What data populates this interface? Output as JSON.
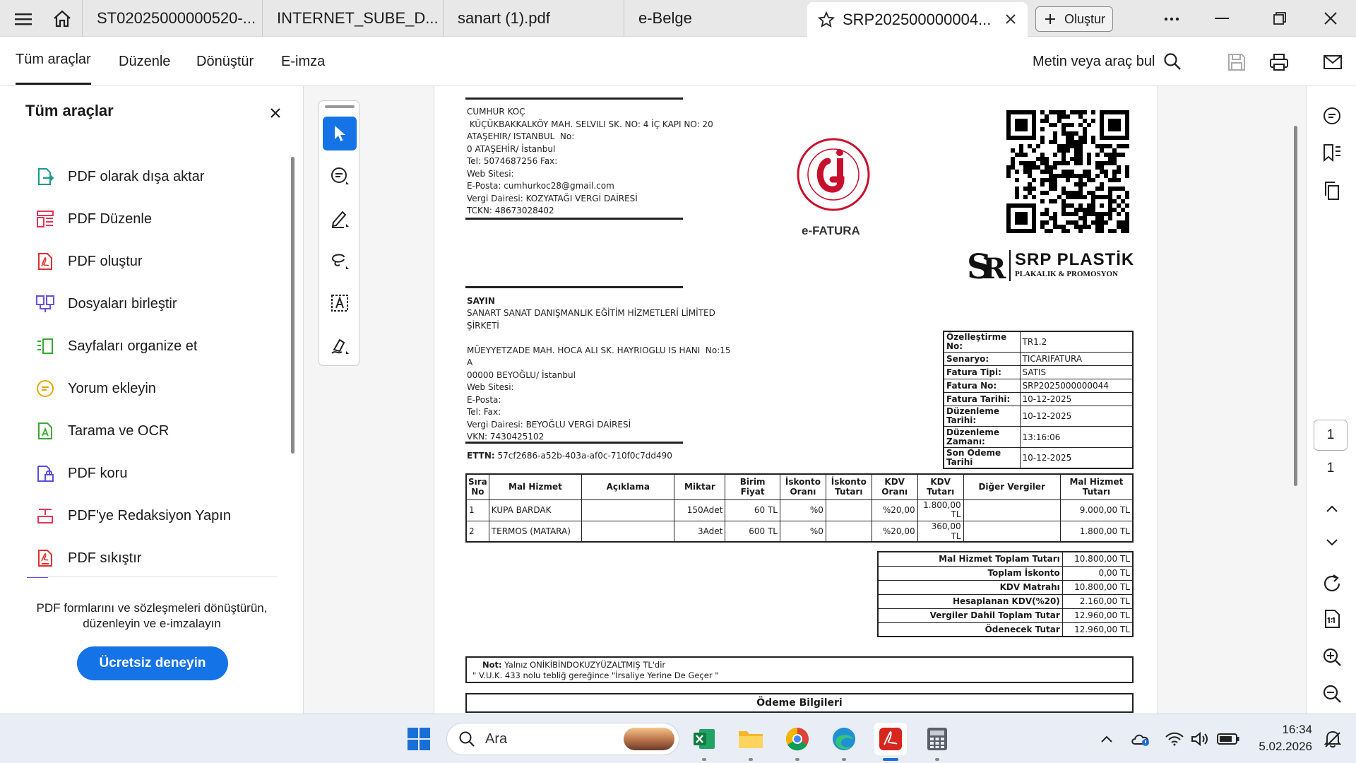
{
  "titlebar": {
    "tabs": [
      {
        "label": "ST02025000000520-..."
      },
      {
        "label": "INTERNET_SUBE_D..."
      },
      {
        "label": "sanart (1).pdf"
      },
      {
        "label": "e-Belge"
      },
      {
        "label": "SRP202500000004..."
      }
    ],
    "create_label": "Oluştur"
  },
  "menubar": {
    "items": [
      "Tüm araçlar",
      "Düzenle",
      "Dönüştür",
      "E-imza"
    ],
    "search_label": "Metin veya araç bul"
  },
  "leftpanel": {
    "title": "Tüm araçlar",
    "tools": [
      {
        "label": "PDF olarak dışa aktar",
        "icon": "export-pdf-icon",
        "color": "#1a9a8a"
      },
      {
        "label": "PDF Düzenle",
        "icon": "edit-pdf-icon",
        "color": "#e0365a"
      },
      {
        "label": "PDF oluştur",
        "icon": "create-pdf-icon",
        "color": "#e03030"
      },
      {
        "label": "Dosyaları birleştir",
        "icon": "combine-files-icon",
        "color": "#6b4fd8"
      },
      {
        "label": "Sayfaları organize et",
        "icon": "organize-pages-icon",
        "color": "#3aa835"
      },
      {
        "label": "Yorum ekleyin",
        "icon": "comment-icon",
        "color": "#e5a800"
      },
      {
        "label": "Tarama ve OCR",
        "icon": "scan-ocr-icon",
        "color": "#3aa835"
      },
      {
        "label": "PDF koru",
        "icon": "protect-pdf-icon",
        "color": "#5a4fd8"
      },
      {
        "label": "PDF'ye Redaksiyon Yapın",
        "icon": "redact-icon",
        "color": "#e0365a"
      },
      {
        "label": "PDF sıkıştır",
        "icon": "compress-pdf-icon",
        "color": "#e03030"
      }
    ],
    "promo_text": "PDF formlarını ve sözleşmeleri dönüştürün, düzenleyin ve e-imzalayın",
    "promo_button": "Ücretsiz deneyin",
    "accent": "#1473e6"
  },
  "document": {
    "seller": {
      "lines": [
        "CUMHUR KOÇ",
        " KÜÇÜKBAKKALKÖY MAH. SELVILI SK. NO: 4 İÇ KAPI NO: 20",
        "ATAŞEHIR/ ISTANBUL  No:",
        "0 ATAŞEHİR/ İstanbul",
        "Tel: 5074687256 Fax:",
        "Web Sitesi:",
        "E-Posta: cumhurkoc28@gmail.com",
        "Vergi Dairesi: KOZYATAĞI VERGİ DAİRESİ",
        "TCKN: 48673028402"
      ]
    },
    "efatura_label": "e-FATURA",
    "logo_sub": "PLAKALIK & PROMOSYON",
    "logo_main": "SRP PLASTİK",
    "buyer": {
      "title": "SAYIN",
      "lines": [
        "SANART SANAT DANIŞMANLIK EĞİTİM HİZMETLERİ LİMİTED",
        "ŞİRKETİ",
        "",
        "MÜEYYETZADE MAH. HOCA ALI SK. HAYRIOGLU IS HANI  No:15",
        "A",
        "00000 BEYOĞLU/ İstanbul",
        "Web Sitesi:",
        "E-Posta:",
        "Tel: Fax:",
        "Vergi Dairesi: BEYOĞLU VERGİ DAİRESİ",
        "VKN: 7430425102"
      ]
    },
    "ettn_label": "ETTN:",
    "ettn": "57cf2686-a52b-403a-af0c-710f0c7dd490",
    "info": [
      {
        "k": "Özelleştirme No:",
        "v": "TR1.2"
      },
      {
        "k": "Senaryo:",
        "v": "TICARIFATURA"
      },
      {
        "k": "Fatura Tipi:",
        "v": "SATIS"
      },
      {
        "k": "Fatura No:",
        "v": "SRP2025000000044"
      },
      {
        "k": "Fatura Tarihi:",
        "v": "10-12-2025"
      },
      {
        "k": "Düzenleme Tarihi:",
        "v": "10-12-2025"
      },
      {
        "k": "Düzenleme Zamanı:",
        "v": "13:16:06"
      },
      {
        "k": "Son Ödeme Tarihi",
        "v": "10-12-2025"
      }
    ],
    "line_headers": [
      "Sıra No",
      "Mal Hizmet",
      "Açıklama",
      "Miktar",
      "Birim Fiyat",
      "İskonto Oranı",
      "İskonto Tutarı",
      "KDV Oranı",
      "KDV Tutarı",
      "Diğer Vergiler",
      "Mal Hizmet Tutarı"
    ],
    "lines": [
      [
        "1",
        "KUPA BARDAK",
        "",
        "150Adet",
        "60 TL",
        "%0",
        "",
        "%20,00",
        "1.800,00 TL",
        "",
        "9.000,00 TL"
      ],
      [
        "2",
        "TERMOS (MATARA)",
        "",
        "3Adet",
        "600 TL",
        "%0",
        "",
        "%20,00",
        "360,00 TL",
        "",
        "1.800,00 TL"
      ]
    ],
    "totals": [
      {
        "k": "Mal Hizmet Toplam Tutarı",
        "v": "10.800,00 TL"
      },
      {
        "k": "Toplam İskonto",
        "v": "0,00 TL"
      },
      {
        "k": "KDV Matrahı",
        "v": "10.800,00 TL"
      },
      {
        "k": "Hesaplanan KDV(%20)",
        "v": "2.160,00 TL"
      },
      {
        "k": "Vergiler Dahil Toplam Tutar",
        "v": "12.960,00 TL"
      },
      {
        "k": "Ödenecek Tutar",
        "v": "12.960,00 TL"
      }
    ],
    "note_label": "Not:",
    "note_text": " Yalnız ONİKİBİNDOKUZYÜZALTMIŞ TL'dir",
    "note_line2": "\" V.U.K. 433 nolu tebliğ gereğince \"İrsaliye Yerine De Geçer \"",
    "payment_title": "Ödeme Bilgileri"
  },
  "rightrail": {
    "page_current": "1",
    "page_total": "1"
  },
  "taskbar": {
    "search_placeholder": "Ara",
    "time": "16:34",
    "date": "5.02.2026"
  }
}
